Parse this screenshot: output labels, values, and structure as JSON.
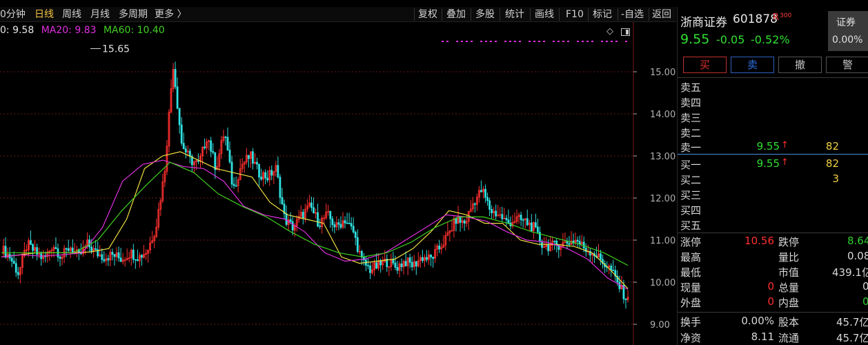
{
  "periods": [
    "0分钟",
    "日线",
    "周线",
    "月线",
    "多周期",
    "更多 〉"
  ],
  "active_period": "日线",
  "toolbar": [
    "复权",
    "叠加",
    "多股",
    "统计",
    "画线",
    "F10",
    "标记",
    "-自选",
    "返回"
  ],
  "ma_legend": [
    {
      "text": "0: 9.58",
      "color": "#e8e8e8"
    },
    {
      "text": "MA20: 9.83",
      "color": "#e030e0"
    },
    {
      "text": "MA60: 10.40",
      "color": "#40d020"
    }
  ],
  "chart_icons": {
    "diamond": "◇",
    "window": "window-icon"
  },
  "high_marker": "15.65",
  "chart_data": {
    "type": "candlestick",
    "y_ticks": [
      "15.00",
      "14.00",
      "13.00",
      "12.00",
      "11.00",
      "10.00",
      "9.00"
    ],
    "ylim": [
      9.0,
      15.5
    ],
    "high_label": "15.65",
    "close_path": [
      10.8,
      10.6,
      10.2,
      10.9,
      10.7,
      10.55,
      10.9,
      10.6,
      10.85,
      10.6,
      10.9,
      10.7,
      10.6,
      10.65,
      10.55,
      10.7,
      10.6,
      10.75,
      11.3,
      12.6,
      15.2,
      13.3,
      12.9,
      12.8,
      13.5,
      12.7,
      13.6,
      12.2,
      12.8,
      13.0,
      12.6,
      12.5,
      12.7,
      11.5,
      11.3,
      11.6,
      11.8,
      11.4,
      11.6,
      11.3,
      11.5,
      11.2,
      10.5,
      10.3,
      10.4,
      10.5,
      10.35,
      10.5,
      10.4,
      10.6,
      10.55,
      10.8,
      11.1,
      11.5,
      11.4,
      11.9,
      12.2,
      11.7,
      11.6,
      11.4,
      11.5,
      11.45,
      11.3,
      10.9,
      10.85,
      10.9,
      10.95,
      11.0,
      10.8,
      10.7,
      10.5,
      10.3,
      9.9,
      9.55
    ],
    "ma_short_path": [
      10.6,
      10.65,
      10.7,
      10.7,
      10.7,
      10.72,
      10.8,
      11.5,
      12.7,
      13.0,
      13.1,
      12.9,
      12.7,
      12.6,
      12.5,
      11.9,
      11.6,
      11.5,
      11.4,
      10.6,
      10.45,
      10.5,
      10.55,
      10.8,
      11.2,
      11.7,
      11.6,
      11.4,
      11.4,
      11.0,
      10.9,
      10.9,
      10.85,
      10.7,
      10.3,
      9.85
    ],
    "ma20_path": [
      10.6,
      10.65,
      10.62,
      10.65,
      10.7,
      11.3,
      12.4,
      12.8,
      12.9,
      12.75,
      12.7,
      12.4,
      11.8,
      11.6,
      11.5,
      11.2,
      10.7,
      10.5,
      10.55,
      10.7,
      11.0,
      11.3,
      11.6,
      11.55,
      11.45,
      11.2,
      11.0,
      10.95,
      10.8,
      10.55,
      10.1,
      9.83
    ],
    "ma60_path": [
      10.7,
      10.7,
      10.7,
      10.7,
      11.0,
      11.7,
      12.3,
      12.85,
      12.6,
      12.1,
      11.8,
      11.55,
      11.2,
      10.9,
      10.7,
      10.6,
      10.7,
      10.95,
      11.3,
      11.55,
      11.55,
      11.4,
      11.2,
      11.05,
      10.9,
      10.7,
      10.4
    ]
  },
  "stock": {
    "name": "浙商证券",
    "code": "601878",
    "tag": "R",
    "tag_sub": "300",
    "price": "9.55",
    "change": "-0.05",
    "change_pct": "-0.52%",
    "box_label": "证券",
    "box_value": "0.00%"
  },
  "trade_buttons": [
    {
      "label": "买",
      "color": "#e03030"
    },
    {
      "label": "卖",
      "color": "#3070e0"
    },
    {
      "label": "撤",
      "color": "#d8d8d8"
    },
    {
      "label": "警",
      "color": "#d8d8d8"
    }
  ],
  "asks": [
    {
      "label": "卖五",
      "price": "",
      "qty": ""
    },
    {
      "label": "卖四",
      "price": "",
      "qty": ""
    },
    {
      "label": "卖三",
      "price": "",
      "qty": ""
    },
    {
      "label": "卖二",
      "price": "",
      "qty": ""
    },
    {
      "label": "卖一",
      "price": "9.55",
      "arrow": "↑",
      "qty": "82"
    }
  ],
  "bids": [
    {
      "label": "买一",
      "price": "9.55",
      "arrow": "↑",
      "qty": "82"
    },
    {
      "label": "买二",
      "price": "",
      "qty": "3"
    },
    {
      "label": "买三",
      "price": "",
      "qty": ""
    },
    {
      "label": "买四",
      "price": "",
      "qty": ""
    },
    {
      "label": "买五",
      "price": "",
      "qty": ""
    }
  ],
  "stats": [
    {
      "l1": "涨停",
      "v1": "10.56",
      "c1": "#ff3030",
      "l2": "跌停",
      "v2": "8.64",
      "c2": "#30d030"
    },
    {
      "l1": "最高",
      "v1": "",
      "c1": "#d8d8d8",
      "l2": "量比",
      "v2": "0.08",
      "c2": "#d8d8d8"
    },
    {
      "l1": "最低",
      "v1": "",
      "c1": "#d8d8d8",
      "l2": "市值",
      "v2": "439.1亿",
      "c2": "#d8d8d8"
    },
    {
      "l1": "现量",
      "v1": "0",
      "c1": "#ff3030",
      "l2": "总量",
      "v2": "0",
      "c2": "#d8d8d8"
    },
    {
      "l1": "外盘",
      "v1": "0",
      "c1": "#ff3030",
      "l2": "内盘",
      "v2": "0",
      "c2": "#30d030"
    }
  ],
  "stats2": [
    {
      "l1": "换手",
      "v1": "0.00%",
      "l2": "股本",
      "v2": "45.7亿"
    },
    {
      "l1": "净资",
      "v1": "8.11",
      "l2": "流通",
      "v2": "45.7亿"
    }
  ],
  "colors": {
    "up": "#ff3030",
    "down": "#30e0e0",
    "ma5": "#f0e040",
    "ma20": "#e030e0",
    "ma60": "#40d020",
    "grid": "#6a1a1a",
    "axis": "#b0b0b0",
    "magenta_dots": "#e030e0"
  }
}
